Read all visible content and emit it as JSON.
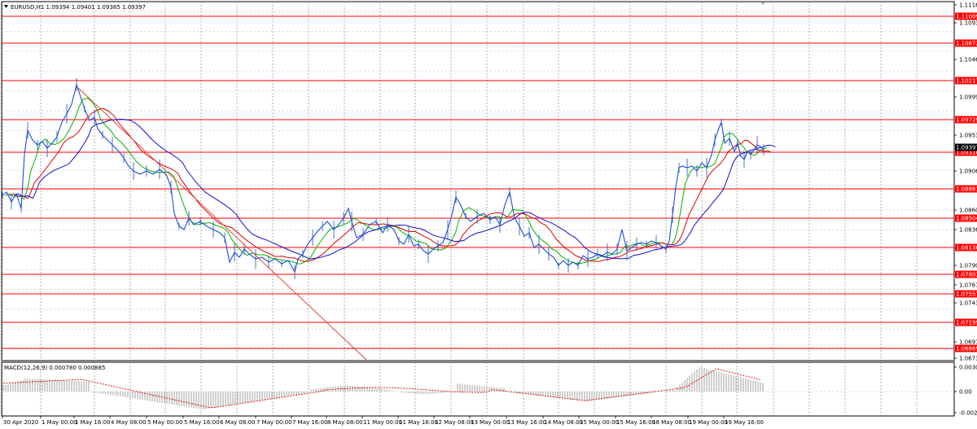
{
  "header": {
    "symbol_line": "EURUSD,H1  1.09394 1.09401 1.09385 1.09397",
    "macd_line": "MACD(12,26,9) 0.000780 0.000885"
  },
  "colors": {
    "price": "#1c4fd1",
    "ma_fast": "#00b400",
    "ma_mid": "#e00000",
    "ma_slow": "#1010d0",
    "level": "#ff0000",
    "macd_hist": "#b0b0b0",
    "macd_signal": "#e00000",
    "grid": "#c8c8c8"
  },
  "price_axis": {
    "min": 1.0673,
    "max": 1.1116,
    "ticks": [
      "1.11165",
      "1.10930",
      "1.10465",
      "1.09995",
      "1.09530",
      "1.09065",
      "1.08600",
      "1.08365",
      "1.07900",
      "1.07670",
      "1.07435",
      "1.06970",
      "1.06735"
    ]
  },
  "levels": [
    "1.11009",
    "1.10672",
    "1.10217",
    "1.09729",
    "1.09310",
    "1.08861",
    "1.08504",
    "1.08136",
    "1.07803",
    "1.07557",
    "1.07199",
    "1.06869"
  ],
  "current_price": "1.09397",
  "macd_axis": {
    "ticks": [
      "0.003016",
      "0.00",
      "-0.00249"
    ]
  },
  "time_labels": [
    "30 Apr 2020",
    "1 May 00:00",
    "1 May 16:00",
    "4 May 08:00",
    "5 May 00:00",
    "5 May 16:00",
    "6 May 08:00",
    "7 May 00:00",
    "7 May 16:00",
    "8 May 08:00",
    "11 May 00:00",
    "11 May 16:00",
    "12 May 08:00",
    "13 May 00:00",
    "13 May 16:00",
    "14 May 08:00",
    "15 May 00:00",
    "15 May 16:00",
    "18 May 08:00",
    "19 May 00:00",
    "19 May 16:00"
  ],
  "chart_data": {
    "type": "line",
    "title": "EURUSD,H1",
    "x": [
      "30 Apr 2020",
      "1 May 00:00",
      "1 May 16:00",
      "4 May 08:00",
      "5 May 00:00",
      "5 May 16:00",
      "6 May 08:00",
      "7 May 00:00",
      "7 May 16:00",
      "8 May 08:00",
      "11 May 00:00",
      "11 May 16:00",
      "12 May 08:00",
      "13 May 00:00",
      "13 May 16:00",
      "14 May 08:00",
      "15 May 00:00",
      "15 May 16:00",
      "18 May 08:00",
      "19 May 00:00",
      "19 May 16:00"
    ],
    "series": [
      {
        "values": [
          1.0865,
          1.095,
          1.101,
          1.093,
          1.091,
          1.088,
          1.083,
          1.079,
          1.0805,
          1.0855,
          1.085,
          1.0825,
          1.086,
          1.0855,
          1.084,
          1.079,
          1.0805,
          1.082,
          1.083,
          1.096,
          1.0938
        ]
      }
    ],
    "ylim": [
      1.06735,
      1.11165
    ],
    "grid": true
  }
}
